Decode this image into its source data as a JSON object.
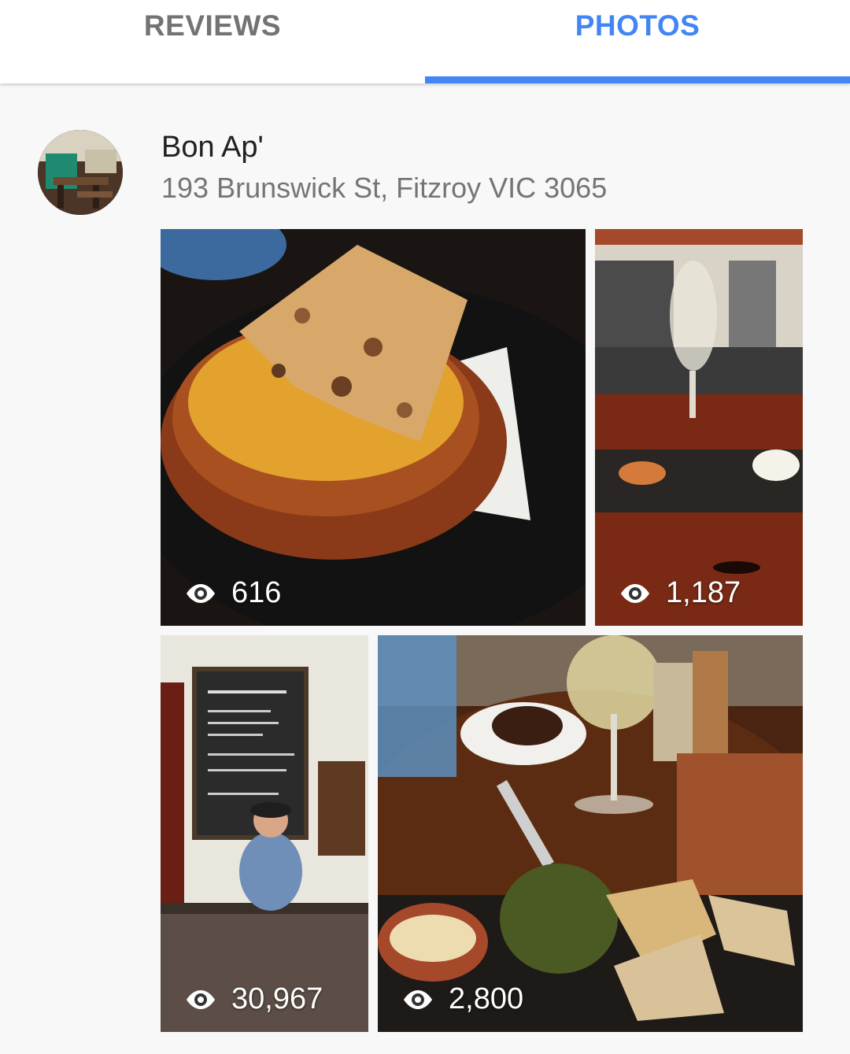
{
  "tabs": {
    "reviews": "REVIEWS",
    "photos": "PHOTOS",
    "active": "photos"
  },
  "place": {
    "name": "Bon Ap'",
    "address": "193 Brunswick St, Fitzroy VIC 3065"
  },
  "photos": [
    {
      "subject": "creme brulee with almond tuile",
      "views": "616"
    },
    {
      "subject": "wine glass and bread on slate at bar",
      "views": "1,187"
    },
    {
      "subject": "chalkboard menu and bartender",
      "views": "30,967"
    },
    {
      "subject": "wine, cheese, bread and pate on table",
      "views": "2,800"
    }
  ],
  "colors": {
    "accent": "#4285f4",
    "inactive_tab": "#737373",
    "background": "#f8f8f8"
  },
  "icons": {
    "views": "eye-icon"
  }
}
